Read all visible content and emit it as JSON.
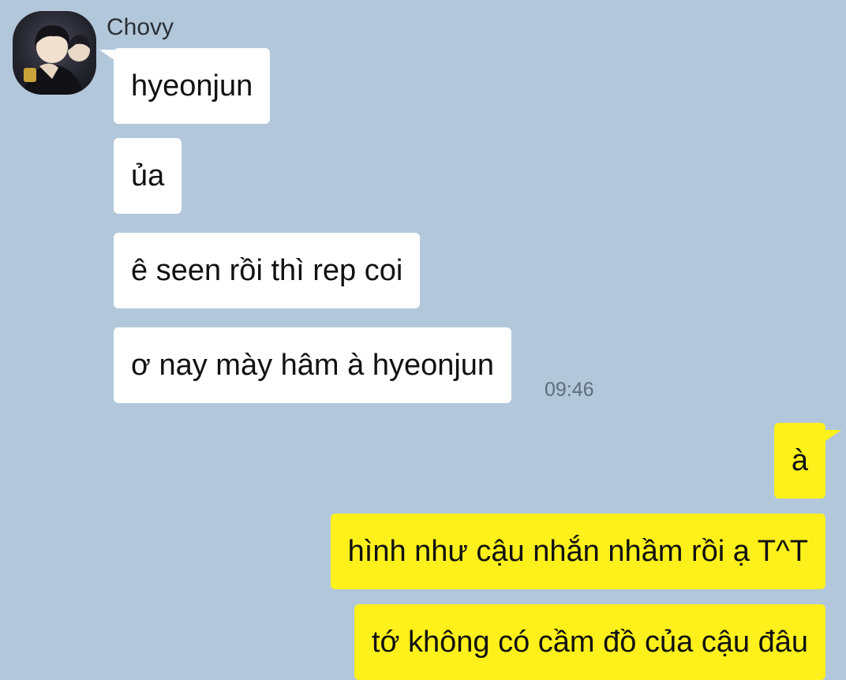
{
  "chat": {
    "sender_name": "Chovy",
    "incoming": [
      "hyeonjun",
      "ủa",
      "ê seen rồi thì rep coi",
      "ơ nay mày hâm à hyeonjun"
    ],
    "incoming_time": "09:46",
    "outgoing": [
      "à",
      "hình như cậu nhắn nhầm rồi ạ T^T",
      "tớ không có cầm đồ của cậu đâu"
    ]
  },
  "colors": {
    "background": "#b2c7da",
    "incoming_bubble": "#ffffff",
    "outgoing_bubble": "#fef01b"
  }
}
